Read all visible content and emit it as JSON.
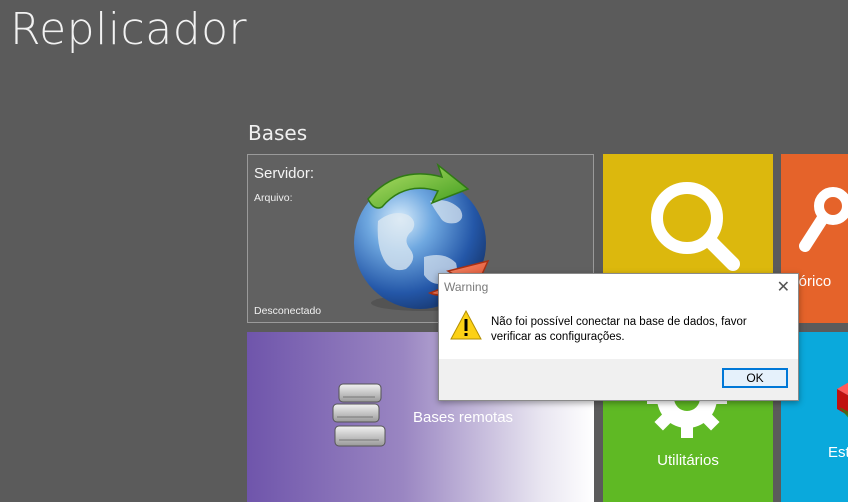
{
  "app": {
    "title": "Replicador"
  },
  "section": {
    "title": "Bases"
  },
  "tiles": {
    "server": {
      "label": "Servidor:",
      "file_label": "Arquivo:",
      "status": "Desconectado"
    },
    "search": {
      "icon": "magnifier-icon",
      "color": "#dcb80d"
    },
    "history": {
      "label": "stórico",
      "color": "#e5632a"
    },
    "remote": {
      "label": "Bases remotas",
      "icon": "database-stack-icon"
    },
    "utilities": {
      "label": "Utilitários",
      "icon": "gear-icon",
      "color": "#5fb924"
    },
    "stats": {
      "label": "Est",
      "icon": "cube-icon",
      "color": "#0aa9dc"
    }
  },
  "dialog": {
    "title": "Warning",
    "close_glyph": "✕",
    "message": "Não foi possível conectar na base de dados, favor verificar as configurações.",
    "ok_label": "OK",
    "icon": "warning-icon"
  }
}
